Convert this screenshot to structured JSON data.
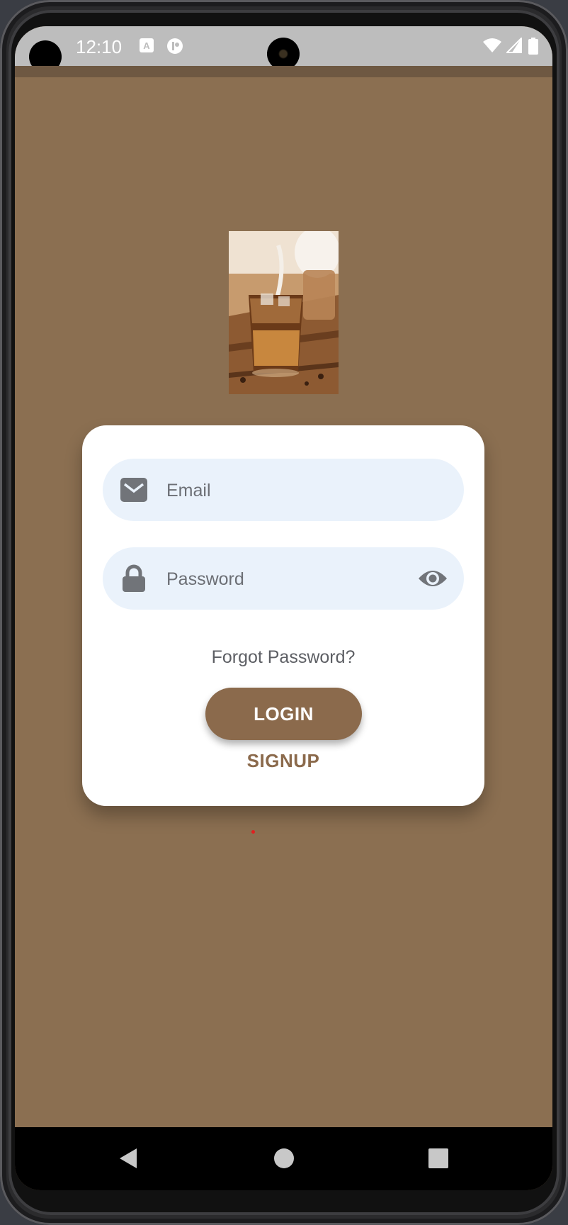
{
  "status_bar": {
    "time": "12:10",
    "icons": [
      "font-a-icon",
      "record-icon",
      "wifi-icon",
      "signal-icon",
      "battery-icon"
    ]
  },
  "login": {
    "email_placeholder": "Email",
    "password_placeholder": "Password",
    "forgot_label": "Forgot Password?",
    "login_label": "LOGIN",
    "signup_label": "SIGNUP"
  },
  "nav": {
    "buttons": [
      "back-icon",
      "home-icon",
      "recents-icon"
    ]
  },
  "colors": {
    "background": "#8b6f51",
    "accent": "#8b6a4c",
    "field_bg": "#eaf2fb"
  }
}
